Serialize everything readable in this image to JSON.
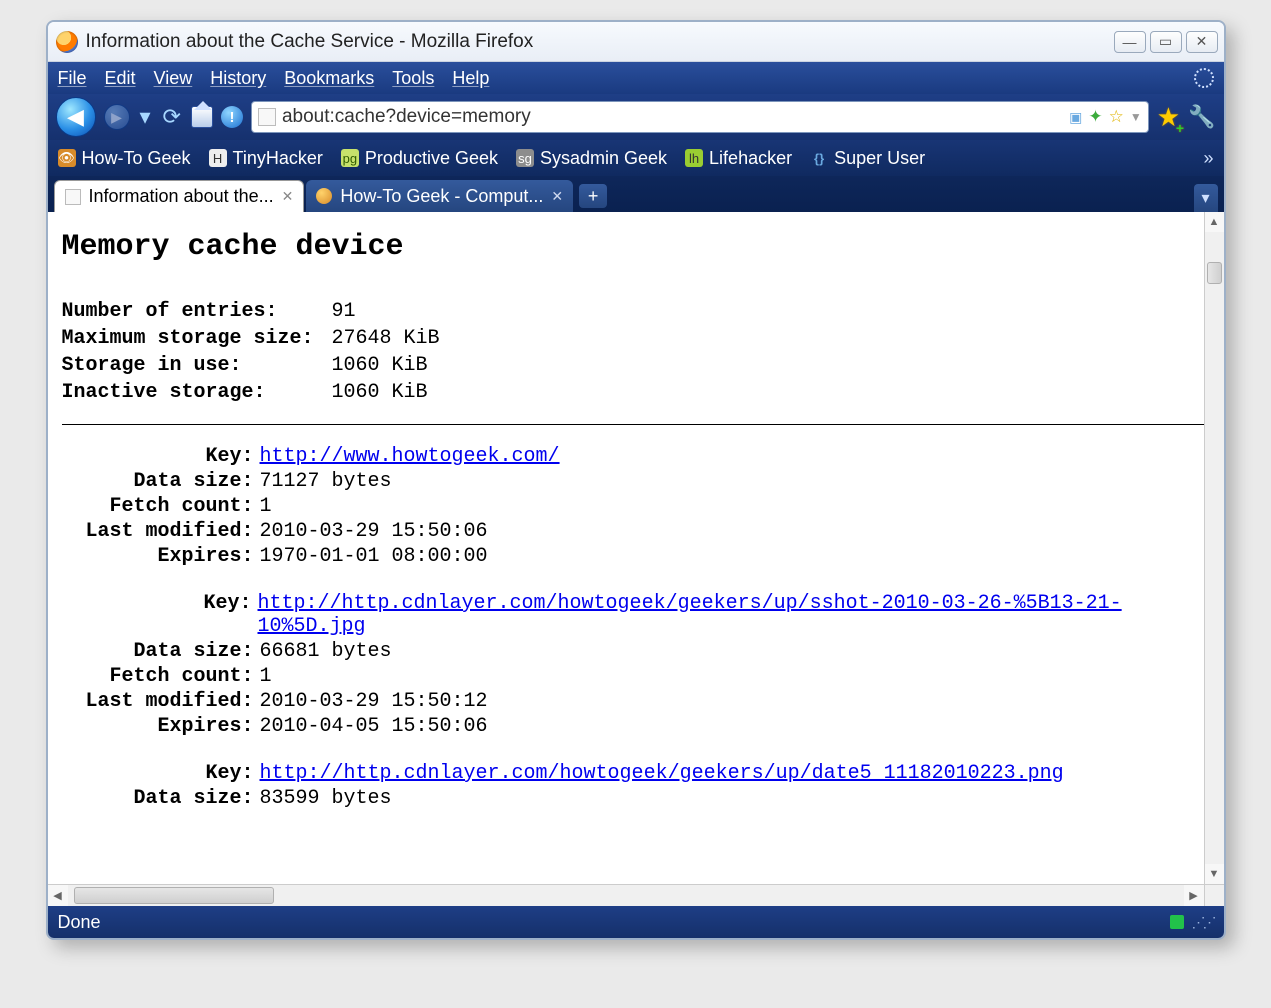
{
  "window": {
    "title": "Information about the Cache Service - Mozilla Firefox"
  },
  "menus": [
    "File",
    "Edit",
    "View",
    "History",
    "Bookmarks",
    "Tools",
    "Help"
  ],
  "url": "about:cache?device=memory",
  "bookmarks": [
    {
      "label": "How-To Geek",
      "ico": "htg"
    },
    {
      "label": "TinyHacker",
      "ico": "th"
    },
    {
      "label": "Productive Geek",
      "ico": "pg"
    },
    {
      "label": "Sysadmin Geek",
      "ico": "sg"
    },
    {
      "label": "Lifehacker",
      "ico": "lh"
    },
    {
      "label": "Super User",
      "ico": "su"
    }
  ],
  "tabs": [
    {
      "label": "Information about the...",
      "active": true
    },
    {
      "label": "How-To Geek - Comput...",
      "active": false
    }
  ],
  "page": {
    "heading": "Memory cache device",
    "stats": {
      "num_entries_label": "Number of entries:",
      "num_entries": "91",
      "max_storage_label": "Maximum storage size:",
      "max_storage": "27648 KiB",
      "storage_in_use_label": "Storage in use:",
      "storage_in_use": "1060 KiB",
      "inactive_label": "Inactive storage:",
      "inactive": "1060 KiB"
    },
    "field_labels": {
      "key": "Key:",
      "data_size": "Data size:",
      "fetch_count": "Fetch count:",
      "last_modified": "Last modified:",
      "expires": "Expires:"
    },
    "entries": [
      {
        "key": "http://www.howtogeek.com/",
        "data_size": "71127 bytes",
        "fetch_count": "1",
        "last_modified": "2010-03-29 15:50:06",
        "expires": "1970-01-01 08:00:00"
      },
      {
        "key": "http://http.cdnlayer.com/howtogeek/geekers/up/sshot-2010-03-26-%5B13-21-10%5D.jpg",
        "data_size": "66681 bytes",
        "fetch_count": "1",
        "last_modified": "2010-03-29 15:50:12",
        "expires": "2010-04-05 15:50:06"
      },
      {
        "key": "http://http.cdnlayer.com/howtogeek/geekers/up/date5_11182010223.png",
        "data_size": "83599 bytes"
      }
    ]
  },
  "status": "Done"
}
